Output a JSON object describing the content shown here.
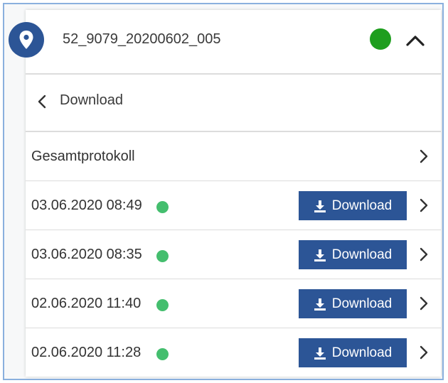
{
  "header": {
    "title": "52_9079_20200602_005",
    "status_color": "#1e9e1e",
    "location_icon": "map-pin-icon",
    "collapse_icon": "chevron-up-icon"
  },
  "back": {
    "label": "Download",
    "icon": "chevron-left-icon"
  },
  "summary_row": {
    "label": "Gesamtprotokoll",
    "icon": "chevron-right-icon"
  },
  "protocols": [
    {
      "timestamp": "03.06.2020 08:49",
      "status_color": "#44be6e",
      "button_label": "Download"
    },
    {
      "timestamp": "03.06.2020 08:35",
      "status_color": "#44be6e",
      "button_label": "Download"
    },
    {
      "timestamp": "02.06.2020 11:40",
      "status_color": "#44be6e",
      "button_label": "Download"
    },
    {
      "timestamp": "02.06.2020 11:28",
      "status_color": "#44be6e",
      "button_label": "Download"
    }
  ],
  "colors": {
    "accent": "#2c5596",
    "status_ok": "#44be6e"
  }
}
